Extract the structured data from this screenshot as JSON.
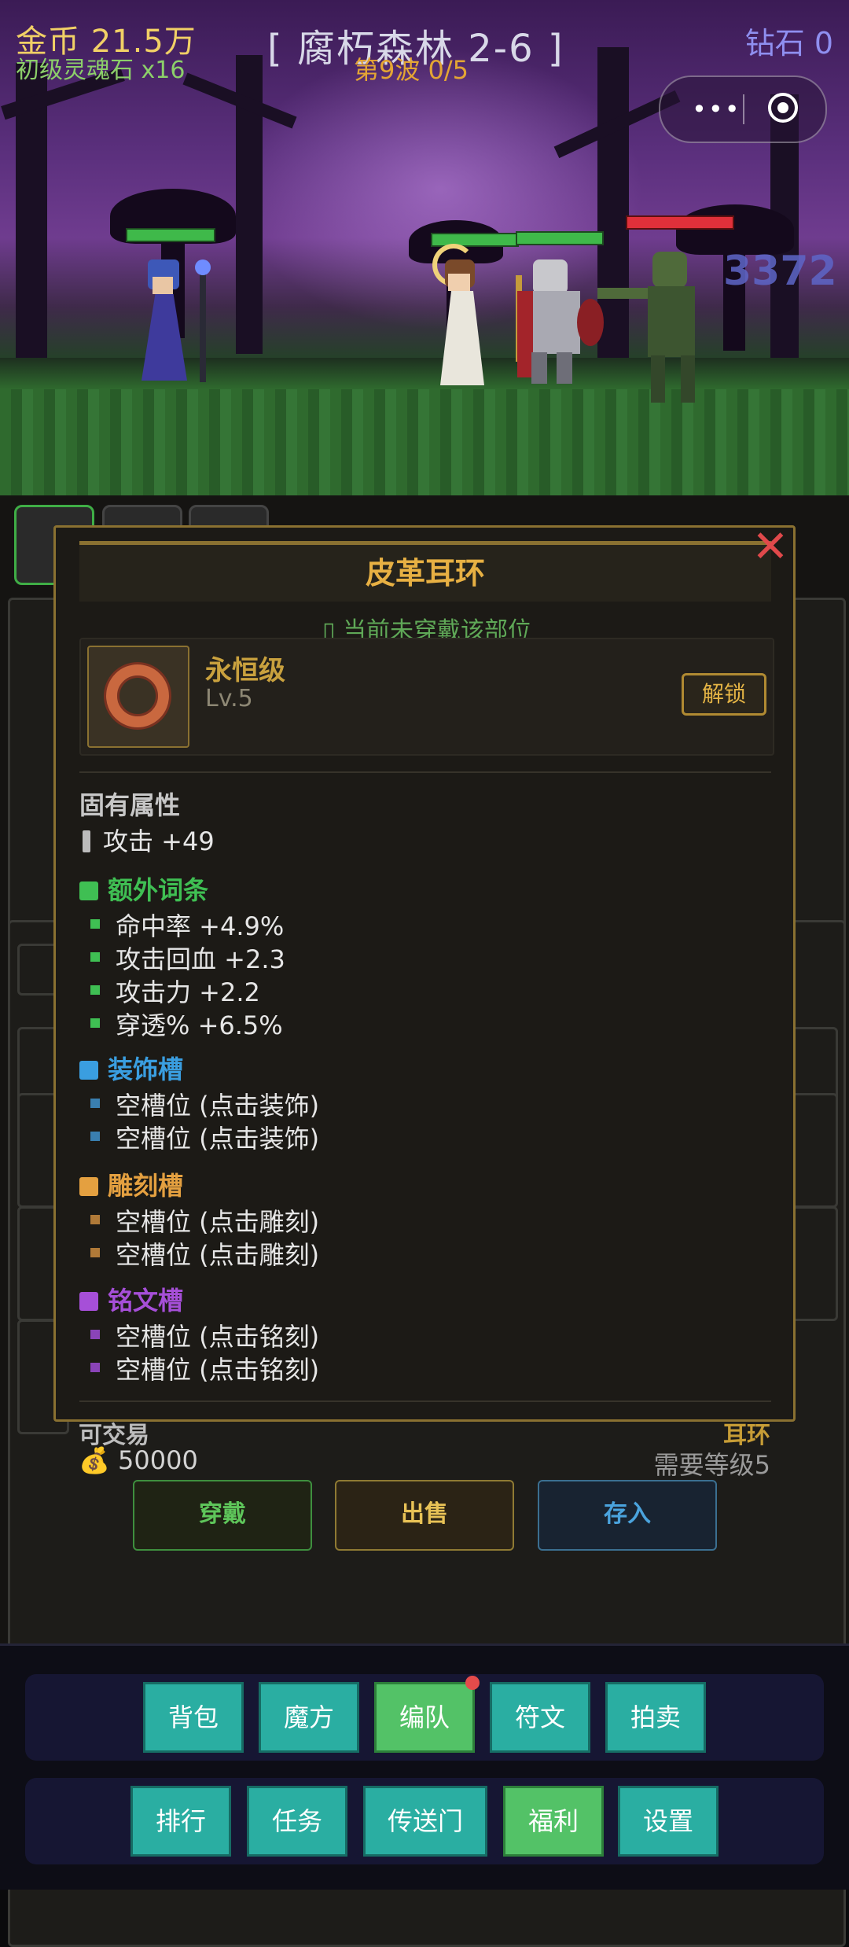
{
  "hud": {
    "gold": "金币 21.5万",
    "soul_stone": "初级灵魂石 x16",
    "stage": "[ 腐朽森林 2-6 ]",
    "wave": "第9波 0/5",
    "diamond": "钻石 0",
    "damage_popup": "3372"
  },
  "miniprogram_capsule": {
    "more_icon": "more-dots-icon",
    "close_icon": "target-circle-icon",
    "more_label": "•••"
  },
  "modal": {
    "title": "皮革耳环",
    "close_label": "✕",
    "status_note": "▯ 当前未穿戴该部位",
    "item": {
      "icon": "leather-earring-icon",
      "grade": "永恒级",
      "level": "Lv.5",
      "unlock_label": "解锁"
    },
    "base_section": {
      "title": "固有属性",
      "stats": [
        "攻击 +49"
      ]
    },
    "extra_section": {
      "title": "额外词条",
      "color": "#3fbf53",
      "lines": [
        "命中率 +4.9%",
        "攻击回血 +2.3",
        "攻击力 +2.2",
        "穿透% +6.5%"
      ]
    },
    "decor_section": {
      "title": "装饰槽",
      "color": "#3a9ee0",
      "lines": [
        "空槽位 (点击装饰)",
        "空槽位 (点击装饰)"
      ]
    },
    "carve_section": {
      "title": "雕刻槽",
      "color": "#e4a040",
      "lines": [
        "空槽位 (点击雕刻)",
        "空槽位 (点击雕刻)"
      ]
    },
    "rune_section": {
      "title": "铭文槽",
      "color": "#a64fd8",
      "lines": [
        "空槽位 (点击铭刻)",
        "空槽位 (点击铭刻)"
      ]
    }
  },
  "footer_info": {
    "tradable": "可交易",
    "price": "💰 50000",
    "slot": "耳环",
    "requirement": "需要等级5"
  },
  "actions": {
    "wear": "穿戴",
    "sell": "出售",
    "store": "存入"
  },
  "menu": {
    "row1": [
      "背包",
      "魔方",
      "编队",
      "符文",
      "拍卖"
    ],
    "row2": [
      "排行",
      "任务",
      "传送门",
      "福利",
      "设置"
    ]
  }
}
